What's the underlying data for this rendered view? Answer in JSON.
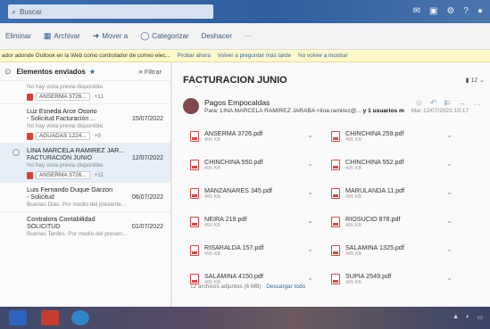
{
  "search": {
    "placeholder": "Buscar"
  },
  "ribbon": [
    {
      "icon": "",
      "label": "Eliminar"
    },
    {
      "icon": "▦",
      "label": "Archivar"
    },
    {
      "icon": "➜",
      "label": "Mover a"
    },
    {
      "icon": "◯",
      "label": "Categorizar"
    },
    {
      "icon": "",
      "label": "Deshacer"
    },
    {
      "icon": "",
      "label": "···"
    }
  ],
  "banner": {
    "text": "ador adonde Outlook en la Web como controlador de correo elec...",
    "link1": "Probar ahora",
    "link2": "Volver a preguntar más tarde",
    "link3": "No volver a mostrar"
  },
  "list": {
    "title": "Elementos enviados",
    "filter": "Filtrar",
    "items": [
      {
        "from": "",
        "subject": "",
        "date": "",
        "preview": "No hay vista previa disponible.",
        "attachment": "ANSERMA 3726...",
        "more": "+11",
        "selected": false,
        "partial": true
      },
      {
        "from": "Luz Esneda Arce Osorio",
        "subject": "- Solicitud Facturación ...",
        "date": "15/07/2022",
        "preview": "No hay vista previa disponible.",
        "attachment": "AGUADAS 1224...",
        "more": "+9",
        "selected": false
      },
      {
        "from": "LINA MARCELA RAMIREZ JAR...",
        "subject": "FACTURACION JUNIO",
        "date": "12/07/2022",
        "preview": "No hay vista previa disponible.",
        "attachment": "ANSERMA 3726...",
        "more": "+11",
        "selected": true
      },
      {
        "from": "Luis Fernando Duque Garzon",
        "subject": "- Solicitud",
        "date": "06/07/2022",
        "preview": "Buenas Dias. Por medio del presente...",
        "attachment": "",
        "more": "",
        "selected": false
      },
      {
        "from": "Contralora Contabilidad",
        "subject": "SOLICITUD",
        "date": "01/07/2022",
        "preview": "Buenas Tardes. Por medio del presen...",
        "attachment": "",
        "more": "",
        "selected": false
      }
    ]
  },
  "message": {
    "subject": "FACTURACION JUNIO",
    "counter": "12",
    "sender": "Pagos Empocaldas",
    "to_prefix": "Para: LINA MARCELA RAMIREZ JARABA <lina.ramirez@...",
    "to_more": "y 1 usuarios m",
    "date": "Mar 12/07/2022 10:17"
  },
  "attachments": [
    {
      "name": "ANSERMA 3726.pdf",
      "size": "496 KB"
    },
    {
      "name": "CHINCHINA 259.pdf",
      "size": "495 KB"
    },
    {
      "name": "CHINCHINA 550.pdf",
      "size": "495 KB"
    },
    {
      "name": "CHINCHINA 552.pdf",
      "size": "495 KB"
    },
    {
      "name": "MANZANARES 345.pdf",
      "size": "495 KB"
    },
    {
      "name": "MARULANDA 11.pdf",
      "size": "495 KB"
    },
    {
      "name": "NEIRA 219.pdf",
      "size": "495 KB"
    },
    {
      "name": "RIOSUCIO 878.pdf",
      "size": "495 KB"
    },
    {
      "name": "RISARALDA 157.pdf",
      "size": "495 KB"
    },
    {
      "name": "SALAMINA 1325.pdf",
      "size": "495 KB"
    },
    {
      "name": "SALAMINA 4150.pdf",
      "size": "495 KB"
    },
    {
      "name": "SUPIA 2549.pdf",
      "size": "495 KB"
    }
  ],
  "attachments_footer": {
    "count_text": "12 archivos adjuntos (6 MB)",
    "download": "Descargar todo"
  },
  "colors": {
    "titlebar": "#2f5e9e",
    "banner": "#fff8c8",
    "accent": "#2e5f9c"
  }
}
